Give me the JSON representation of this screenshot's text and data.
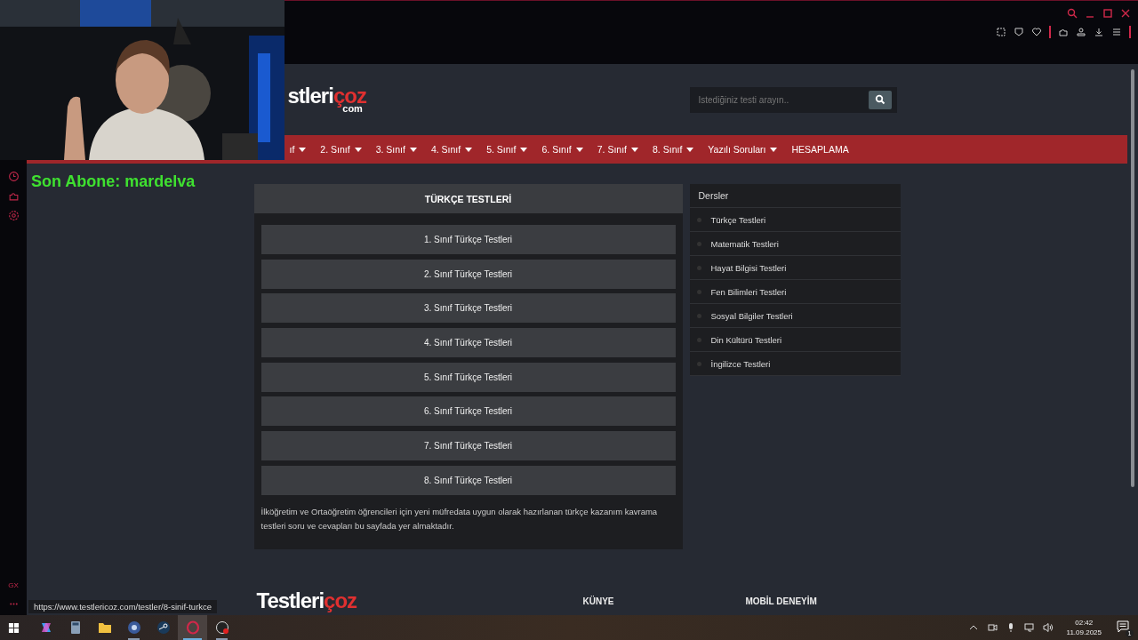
{
  "site": {
    "logo": {
      "main": "stleri",
      "accent": "çoz",
      "suffix": "com"
    },
    "search": {
      "placeholder": "İstediğiniz testi arayın.."
    },
    "nav": [
      {
        "label": "ıf",
        "dropdown": true
      },
      {
        "label": "2. Sınıf",
        "dropdown": true
      },
      {
        "label": "3. Sınıf",
        "dropdown": true
      },
      {
        "label": "4. Sınıf",
        "dropdown": true
      },
      {
        "label": "5. Sınıf",
        "dropdown": true
      },
      {
        "label": "6. Sınıf",
        "dropdown": true
      },
      {
        "label": "7. Sınıf",
        "dropdown": true
      },
      {
        "label": "8. Sınıf",
        "dropdown": true
      },
      {
        "label": "Yazılı Soruları",
        "dropdown": true
      },
      {
        "label": "HESAPLAMA",
        "dropdown": false
      }
    ]
  },
  "overlay_text": "Son Abone: mardelva",
  "main": {
    "title": "TÜRKÇE TESTLERİ",
    "links": [
      "1. Sınıf Türkçe Testleri",
      "2. Sınıf Türkçe Testleri",
      "3. Sınıf Türkçe Testleri",
      "4. Sınıf Türkçe Testleri",
      "5. Sınıf Türkçe Testleri",
      "6. Sınıf Türkçe Testleri",
      "7. Sınıf Türkçe Testleri",
      "8. Sınıf Türkçe Testleri"
    ],
    "description": "İlköğretim ve Ortaöğretim öğrencileri için yeni müfredata uygun olarak hazırlanan türkçe kazanım kavrama testleri soru ve cevapları bu sayfada yer almaktadır."
  },
  "sidebar": {
    "title": "Dersler",
    "items": [
      "Türkçe Testleri",
      "Matematik Testleri",
      "Hayat Bilgisi Testleri",
      "Fen Bilimleri Testleri",
      "Sosyal Bilgiler Testleri",
      "Din Kültürü Testleri",
      "İngilizce Testleri"
    ]
  },
  "footer": {
    "logo": {
      "main": "Testleri",
      "accent": "çoz"
    },
    "columns": [
      "KÜNYE",
      "MOBİL DENEYİM"
    ]
  },
  "browser": {
    "brand": "GX",
    "status_url": "https://www.testlericoz.com/testler/8-sinif-turkce"
  },
  "taskbar": {
    "apps": [
      {
        "kind": "copilot",
        "running": false,
        "selected": false
      },
      {
        "kind": "calculator",
        "running": false,
        "selected": false
      },
      {
        "kind": "folder",
        "running": false,
        "selected": false
      },
      {
        "kind": "disc",
        "running": true,
        "selected": false
      },
      {
        "kind": "steam",
        "running": false,
        "selected": false
      },
      {
        "kind": "opera",
        "running": true,
        "selected": true
      },
      {
        "kind": "obs",
        "running": true,
        "selected": false
      }
    ],
    "time": "02:42",
    "date": "11.09.2025",
    "notifications": "1"
  }
}
